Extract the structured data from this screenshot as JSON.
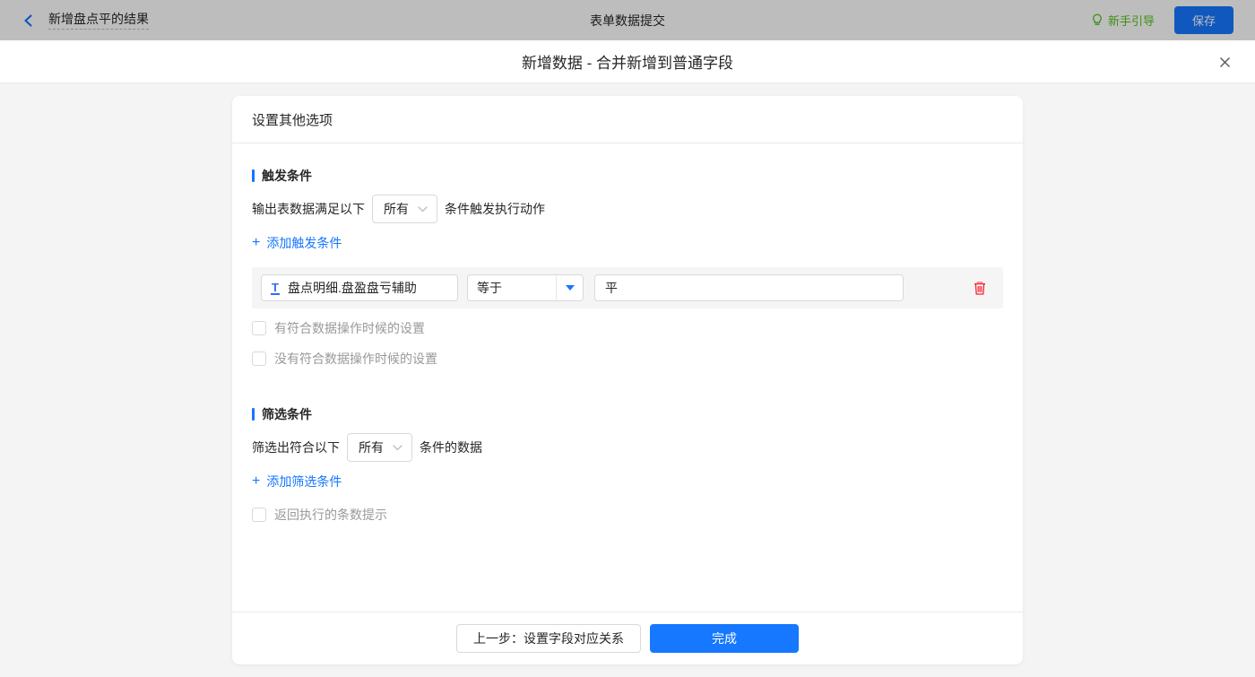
{
  "top_bar": {
    "back_label": "新增盘点平的结果",
    "center_title": "表单数据提交",
    "guide_label": "新手引导",
    "save_label": "保存"
  },
  "modal": {
    "title": "新增数据 - 合并新增到普通字段",
    "card": {
      "header": "设置其他选项",
      "trigger_section": {
        "title": "触发条件",
        "sentence_prefix": "输出表数据满足以下",
        "match_select_value": "所有",
        "sentence_suffix": "条件触发执行动作",
        "add_link_label": "添加触发条件",
        "condition": {
          "field": "盘点明细.盘盈盘亏辅助",
          "operator": "等于",
          "value": "平"
        },
        "checkbox_has_match": "有符合数据操作时候的设置",
        "checkbox_no_match": "没有符合数据操作时候的设置"
      },
      "filter_section": {
        "title": "筛选条件",
        "sentence_prefix": "筛选出符合以下",
        "match_select_value": "所有",
        "sentence_suffix": "条件的数据",
        "add_link_label": "添加筛选条件",
        "checkbox_return_count": "返回执行的条数提示"
      },
      "footer": {
        "prev_label": "上一步：设置字段对应关系",
        "finish_label": "完成"
      }
    }
  },
  "icons": {
    "plus": "+",
    "text_field_type": "T",
    "close": "✕"
  },
  "colors": {
    "primary_blue": "#1677ff",
    "link_blue": "#1677ff",
    "danger_red": "#f5222d",
    "guide_green": "#52c41a",
    "topbar_dim_overlay": "rgba(0,0,0,0.26)",
    "condition_row_bg": "#f5f5f5",
    "body_bg": "#f4f4f4"
  }
}
